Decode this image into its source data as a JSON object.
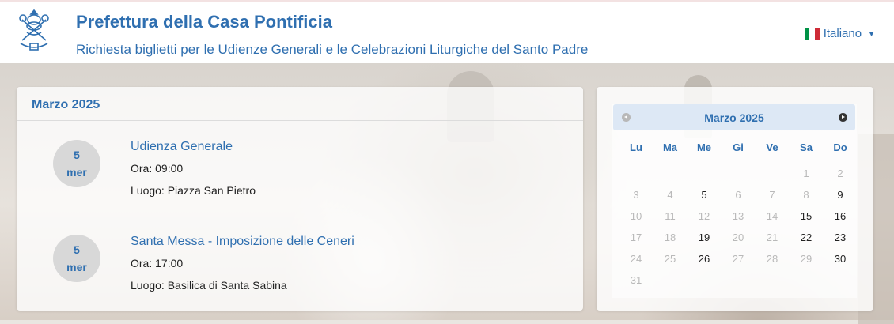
{
  "header": {
    "title": "Prefettura della Casa Pontificia",
    "subtitle": "Richiesta biglietti per le Udienze Generali e le Celebrazioni Liturgiche del Santo Padre",
    "language": "Italiano"
  },
  "events": {
    "month": "Marzo 2025",
    "items": [
      {
        "day": "5",
        "weekday": "mer",
        "title": "Udienza Generale",
        "time": "Ora: 09:00",
        "place": "Luogo: Piazza San Pietro"
      },
      {
        "day": "5",
        "weekday": "mer",
        "title": "Santa Messa - Imposizione delle Ceneri",
        "time": "Ora: 17:00",
        "place": "Luogo: Basilica di Santa Sabina"
      }
    ]
  },
  "calendar": {
    "title": "Marzo 2025",
    "weekdays": [
      "Lu",
      "Ma",
      "Me",
      "Gi",
      "Ve",
      "Sa",
      "Do"
    ],
    "first_weekday_index": 5,
    "days_in_month": 31,
    "active_days": [
      5,
      9,
      15,
      16,
      19,
      22,
      23,
      26,
      30
    ]
  },
  "colors": {
    "accent": "#2f6fb0",
    "calendar_header": "#dde8f5",
    "flag": [
      "#009246",
      "#ffffff",
      "#ce2b37"
    ]
  }
}
